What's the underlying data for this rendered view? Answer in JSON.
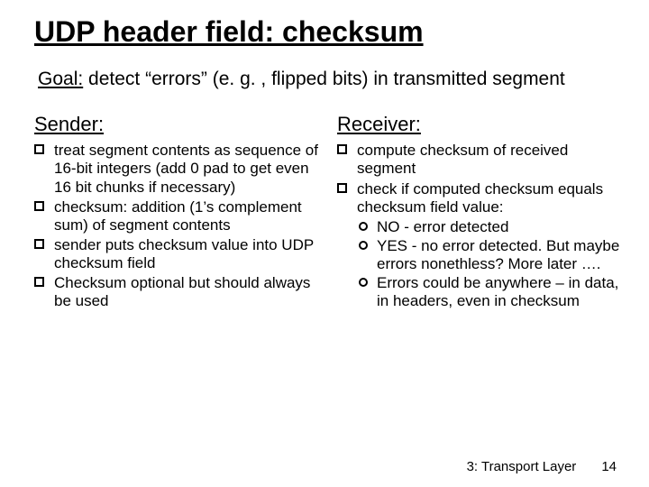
{
  "title": "UDP header field: checksum",
  "goal": {
    "label": "Goal:",
    "text": " detect “errors” (e. g. , flipped bits) in transmitted segment"
  },
  "left": {
    "heading": "Sender:",
    "items": [
      "treat segment contents as sequence of 16-bit integers (add 0 pad to get even 16 bit chunks if necessary)",
      "checksum: addition (1’s complement sum) of segment contents",
      "sender puts checksum value into UDP checksum field",
      "Checksum optional but should always be used"
    ]
  },
  "right": {
    "heading": "Receiver:",
    "items": [
      {
        "text": "compute checksum of received segment"
      },
      {
        "text": "check if computed checksum equals checksum field value:",
        "sub": [
          "NO - error detected",
          "YES - no error detected. But maybe errors nonethless? More later ….",
          "Errors could be anywhere – in data, in headers, even in checksum"
        ]
      }
    ]
  },
  "footer": {
    "section": "3: Transport Layer",
    "page": "14"
  }
}
